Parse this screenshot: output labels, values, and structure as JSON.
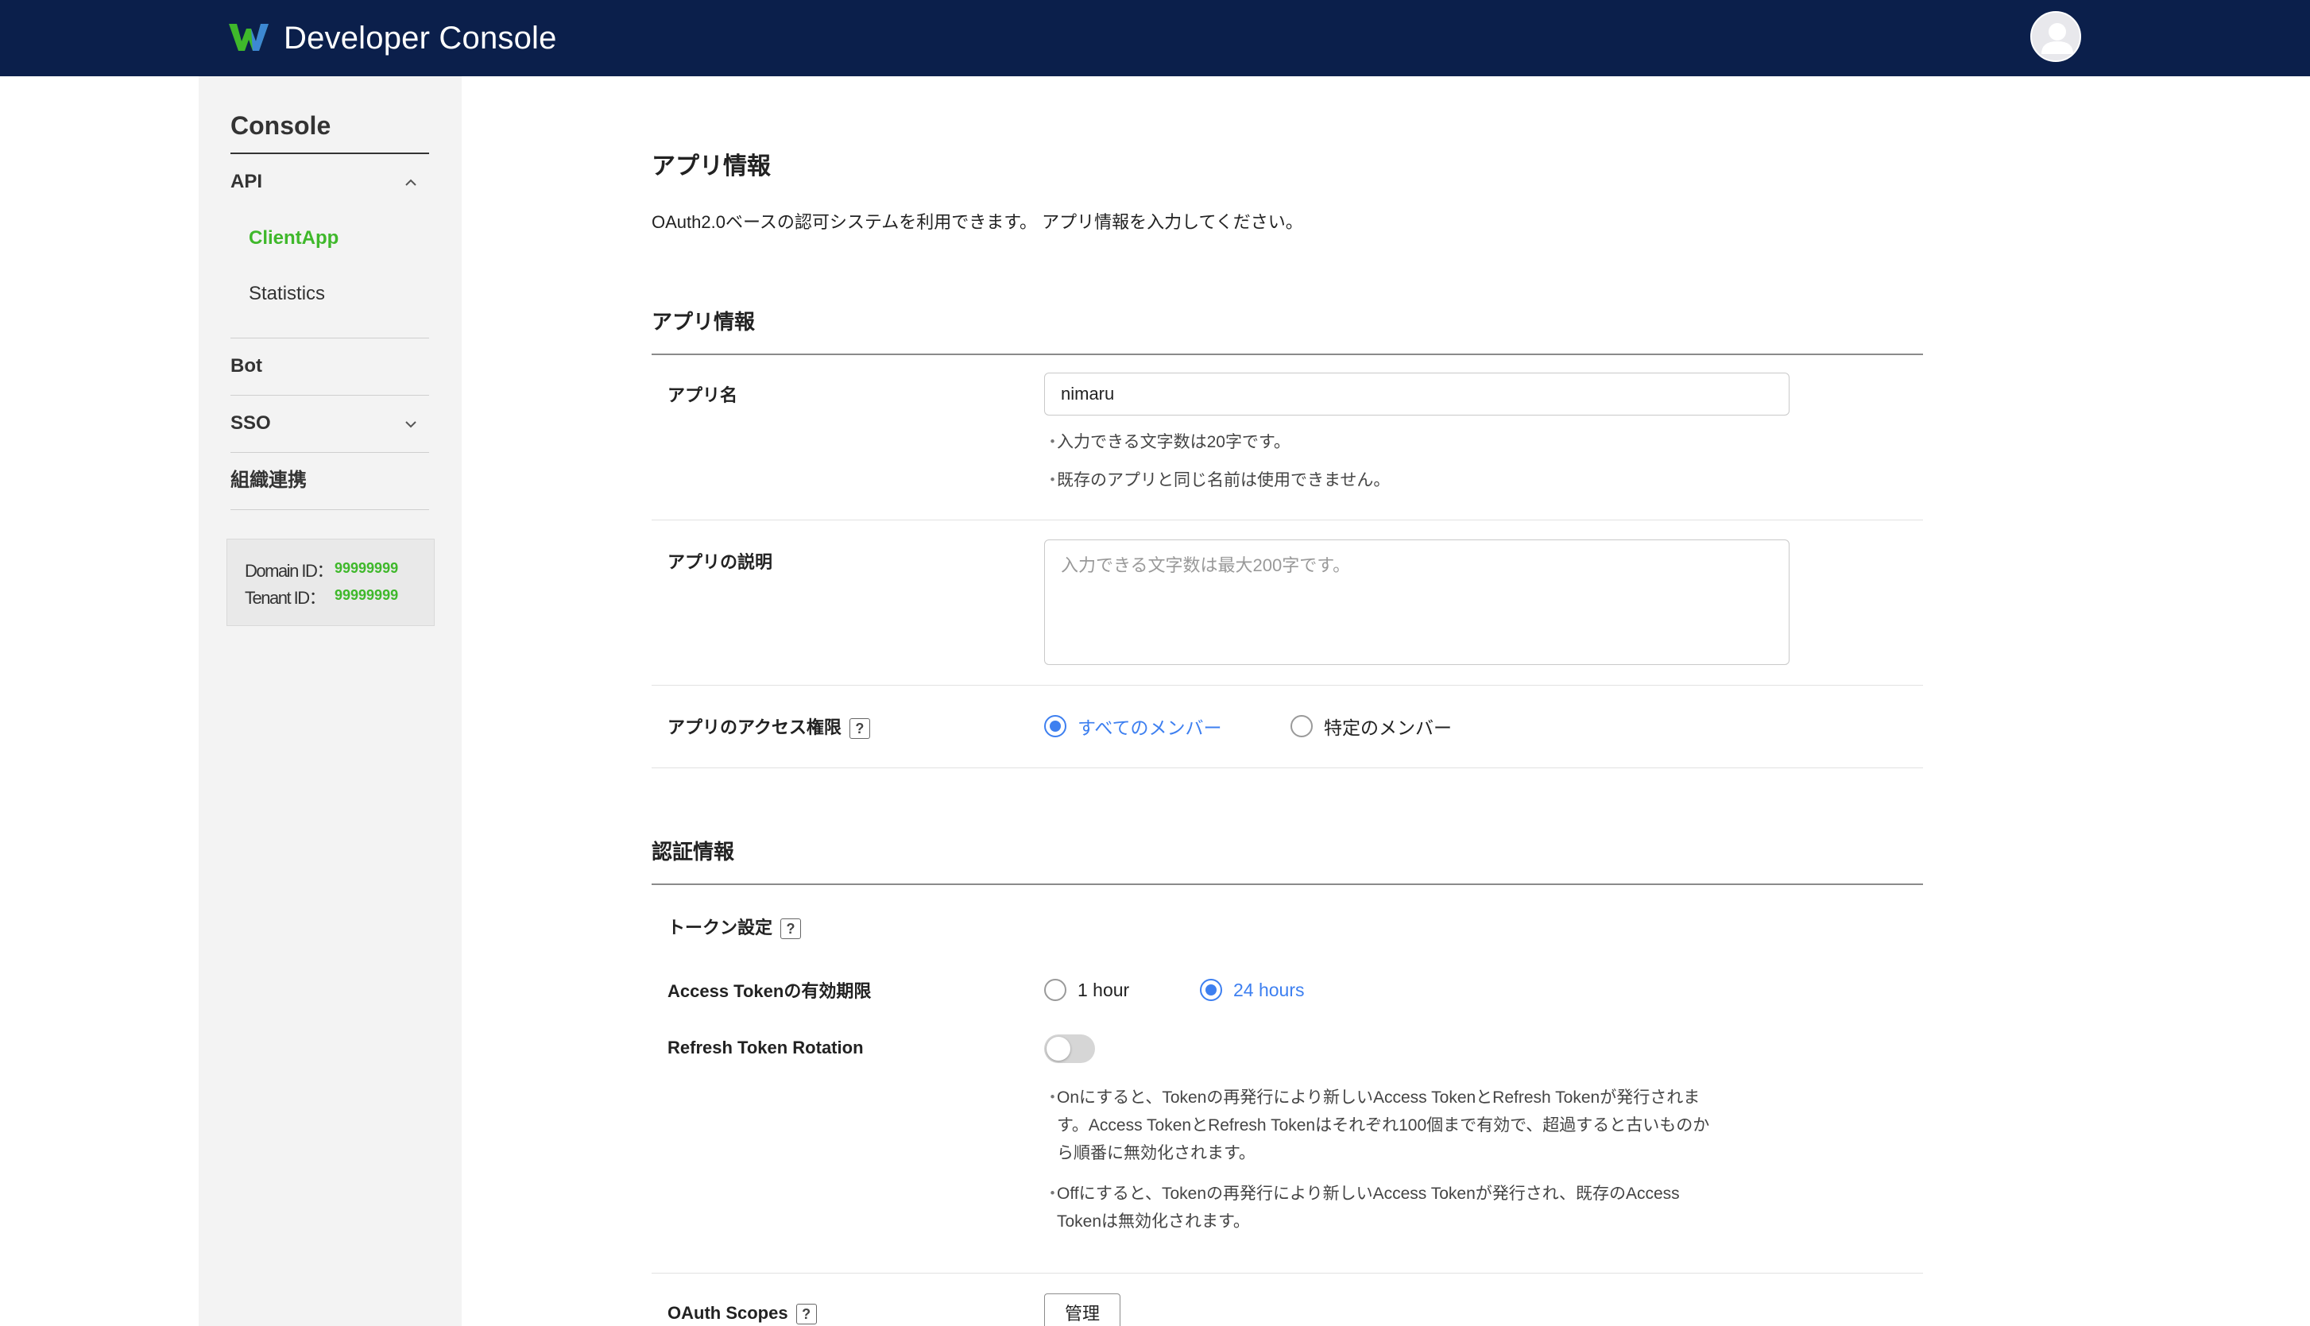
{
  "header": {
    "app_title": "Developer Console",
    "logo_colors": [
      "#3fb82b",
      "#3d7ff0"
    ],
    "background": "#0b1f4b"
  },
  "sidebar": {
    "title": "Console",
    "api_label": "API",
    "api_sub": [
      {
        "label": "ClientApp",
        "active": true
      },
      {
        "label": "Statistics",
        "active": false
      }
    ],
    "bot_label": "Bot",
    "sso_label": "SSO",
    "org_label": "組織連携",
    "domain_id_label": "Domain ID：",
    "domain_id_value": "99999999",
    "tenant_id_label": "Tenant ID：",
    "tenant_id_value": "99999999"
  },
  "main": {
    "page_title": "アプリ情報",
    "intro": "OAuth2.0ベースの認可システムを利用できます。 アプリ情報を入力してください。",
    "section_app": "アプリ情報",
    "app_name_label": "アプリ名",
    "app_name_value": "nimaru",
    "app_name_hint1": "入力できる文字数は20字です。",
    "app_name_hint2": "既存のアプリと同じ名前は使用できません。",
    "app_desc_label": "アプリの説明",
    "app_desc_placeholder": "入力できる文字数は最大200字です。",
    "access_label": "アプリのアクセス権限",
    "access_all": "すべてのメンバー",
    "access_specific": "特定のメンバー",
    "section_auth": "認証情報",
    "token_setting_label": "トークン設定",
    "access_token_label": "Access Tokenの有効期限",
    "token_1h": "1 hour",
    "token_24h": "24 hours",
    "refresh_label": "Refresh Token Rotation",
    "refresh_hint1_l1": "Onにすると、Tokenの再発行により新しいAccess TokenとRefresh Tokenが発行されま",
    "refresh_hint1_l2": "す。Access TokenとRefresh Tokenはそれぞれ100個まで有効で、超過すると古いものか",
    "refresh_hint1_l3": "ら順番に無効化されます。",
    "refresh_hint2_l1": "Offにすると、Tokenの再発行により新しいAccess Tokenが発行され、既存のAccess",
    "refresh_hint2_l2": "Tokenは無効化されます。",
    "oauth_scopes_label": "OAuth Scopes",
    "manage_button": "管理",
    "qmark": "?"
  },
  "colors": {
    "accent_green": "#3fb82b",
    "accent_blue": "#3d7ff0"
  },
  "icons": [
    "logo-icon",
    "user-avatar-icon",
    "chevron-up-icon",
    "chevron-down-icon",
    "help-icon"
  ]
}
